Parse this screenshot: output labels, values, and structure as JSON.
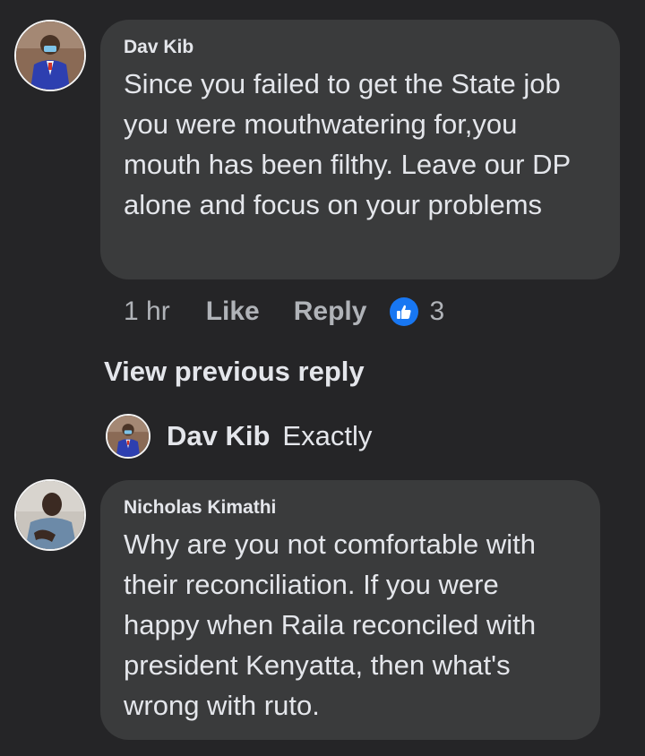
{
  "comment1": {
    "author": "Dav Kib",
    "text": "Since you failed to get the State job you were mouthwatering for,you mouth has been filthy. Leave our DP alone and focus on your problems",
    "time": "1 hr",
    "like_label": "Like",
    "reply_label": "Reply",
    "reaction_count": "3",
    "reaction_icon": "thumbs-up-icon"
  },
  "view_previous_reply": "View previous reply",
  "reply": {
    "author": "Dav Kib",
    "text": "Exactly"
  },
  "comment2": {
    "author": "Nicholas Kimathi",
    "text": "Why are you not comfortable with their reconciliation. If you were happy when Raila reconciled with president Kenyatta, then what's wrong with ruto."
  },
  "colors": {
    "background": "#252527",
    "bubble": "#3a3b3c",
    "text": "#e4e6eb",
    "secondary_text": "#b0b3b8",
    "like_blue": "#1877f2"
  }
}
